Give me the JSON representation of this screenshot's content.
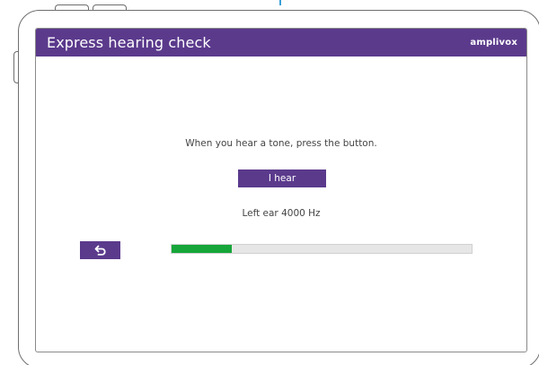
{
  "header": {
    "title": "Express hearing check",
    "brand": "amplivox"
  },
  "main": {
    "instruction": "When you hear a tone, press the button.",
    "hear_button_label": "I hear",
    "ear_frequency": "Left ear 4000 Hz",
    "back_button_icon": "undo-arrow-icon",
    "progress_fraction": 0.2
  },
  "colors": {
    "header_bg": "#5b3a8c",
    "button_bg": "#5b3a8c",
    "progress_fill": "#16a63a",
    "progress_track": "#e6e6e6"
  }
}
